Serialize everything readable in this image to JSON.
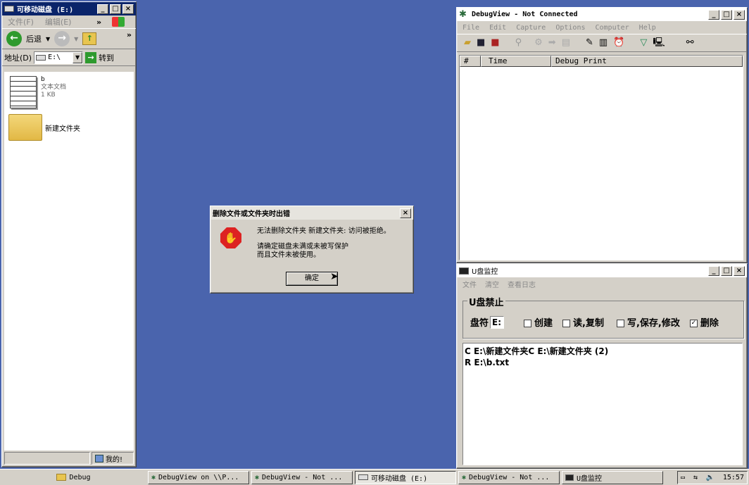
{
  "explorer": {
    "title": "可移动磁盘 (E:)",
    "menu": [
      "文件(F)",
      "编辑(E)"
    ],
    "back_label": "后退",
    "address_label": "地址(D)",
    "address_value": "E:\\",
    "go_label": "转到",
    "files": [
      {
        "name": "b",
        "type": "文本文档",
        "size": "1 KB",
        "icon": "text-file-icon"
      },
      {
        "name": "新建文件夹",
        "icon": "folder-icon"
      }
    ],
    "status_right": "我的!"
  },
  "debugview": {
    "title": "DebugView - Not Connected",
    "menu": [
      "File",
      "Edit",
      "Capture",
      "Options",
      "Computer",
      "Help"
    ],
    "columns": [
      "#",
      "Time",
      "Debug Print"
    ]
  },
  "dialog": {
    "title": "删除文件或文件夹时出错",
    "message1": "无法删除文件夹 新建文件夹: 访问被拒绝。",
    "message2": "请确定磁盘未满或未被写保护",
    "message3": "而且文件未被使用。",
    "ok_label": "确定",
    "icon": "stop-icon"
  },
  "usb_monitor": {
    "title": "U盘监控",
    "menu": [
      "文件",
      "清空",
      "查看日志"
    ],
    "group_label": "U盘禁止",
    "drive_label": "盘符",
    "drive_value": "E:",
    "options": [
      {
        "label": "创建",
        "checked": false
      },
      {
        "label": "读,复制",
        "checked": false
      },
      {
        "label": "写,保存,修改",
        "checked": false
      },
      {
        "label": "删除",
        "checked": true
      }
    ],
    "log_lines": [
      "C E:\\新建文件夹C E:\\新建文件夹 (2)",
      "R E:\\b.txt"
    ]
  },
  "taskbar": {
    "items": [
      {
        "label": "Debug",
        "icon": "folder-icon",
        "pressed": false
      },
      {
        "label": "DebugView on \\\\P...",
        "icon": "bug-icon",
        "pressed": false
      },
      {
        "label": "DebugView - Not ...",
        "icon": "bug-icon",
        "pressed": false
      },
      {
        "label": "可移动磁盘 (E:)",
        "icon": "drive-icon",
        "pressed": true
      },
      {
        "label": "DebugView - Not ...",
        "icon": "bug-icon",
        "pressed": false
      },
      {
        "label": "U盘监控",
        "icon": "monitor-icon",
        "pressed": false
      }
    ],
    "clock": "15:57"
  }
}
